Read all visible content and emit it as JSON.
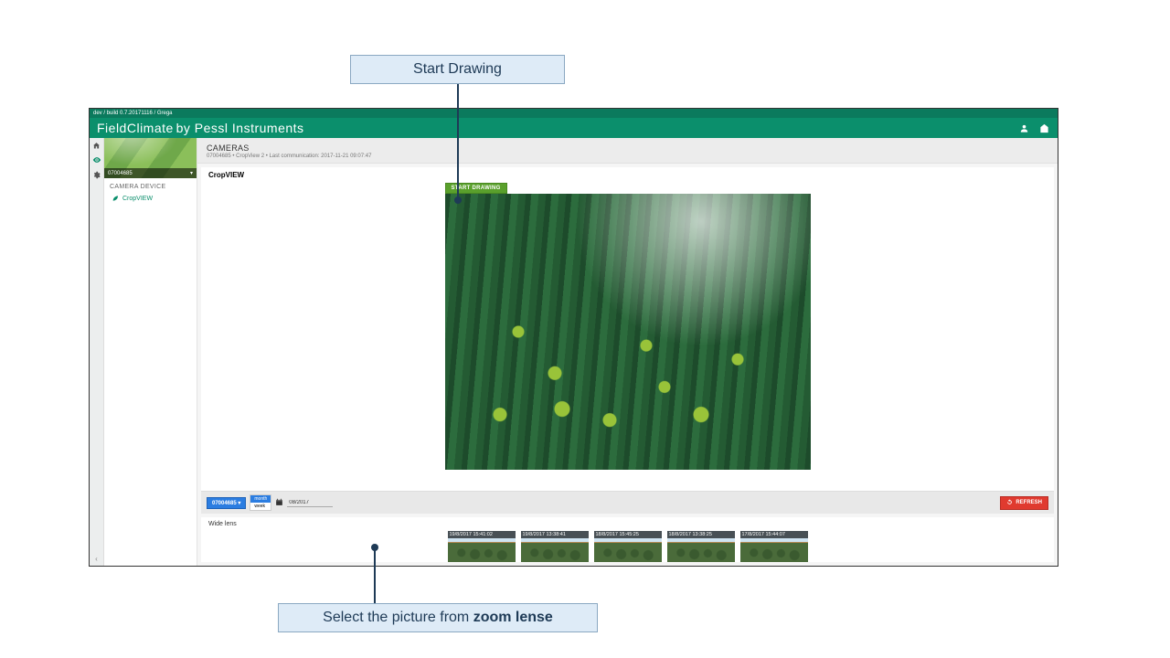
{
  "callouts": {
    "top": "Start Drawing",
    "bottom_prefix": "Select the picture from ",
    "bottom_bold": "zoom lense"
  },
  "build_label": "dev / build 0.7.20171116 / Grega",
  "brand": {
    "name": "FieldClimate",
    "sub": "by Pessl Instruments"
  },
  "topbar_icons": {
    "user": "user-icon",
    "help": "help-icon"
  },
  "iconbar": {
    "home": "home-icon",
    "eye": "eye-icon",
    "gear": "gear-icon",
    "collapse": "collapse-icon"
  },
  "sidebar": {
    "station_id": "07004685",
    "section_title": "CAMERA DEVICE",
    "items": [
      {
        "label": "CropVIEW"
      }
    ]
  },
  "page_header": {
    "title": "CAMERAS",
    "subtitle": "07004685 • CropView 2 • Last communication: 2017-11-21 09:07:47"
  },
  "panel": {
    "title": "CropVIEW",
    "start_drawing": "START DRAWING"
  },
  "footer": {
    "station_btn": "07004685 ▾",
    "seg": {
      "month": "month",
      "week": "week",
      "active": "month"
    },
    "month_value": "08/2017",
    "refresh": "REFRESH"
  },
  "thumbs": {
    "title": "Wide lens",
    "items": [
      {
        "ts": "19/8/2017 15:41:02"
      },
      {
        "ts": "19/8/2017 13:38:41"
      },
      {
        "ts": "18/8/2017 15:45:25"
      },
      {
        "ts": "18/8/2017 13:38:25"
      },
      {
        "ts": "17/8/2017 15:44:07"
      }
    ]
  }
}
